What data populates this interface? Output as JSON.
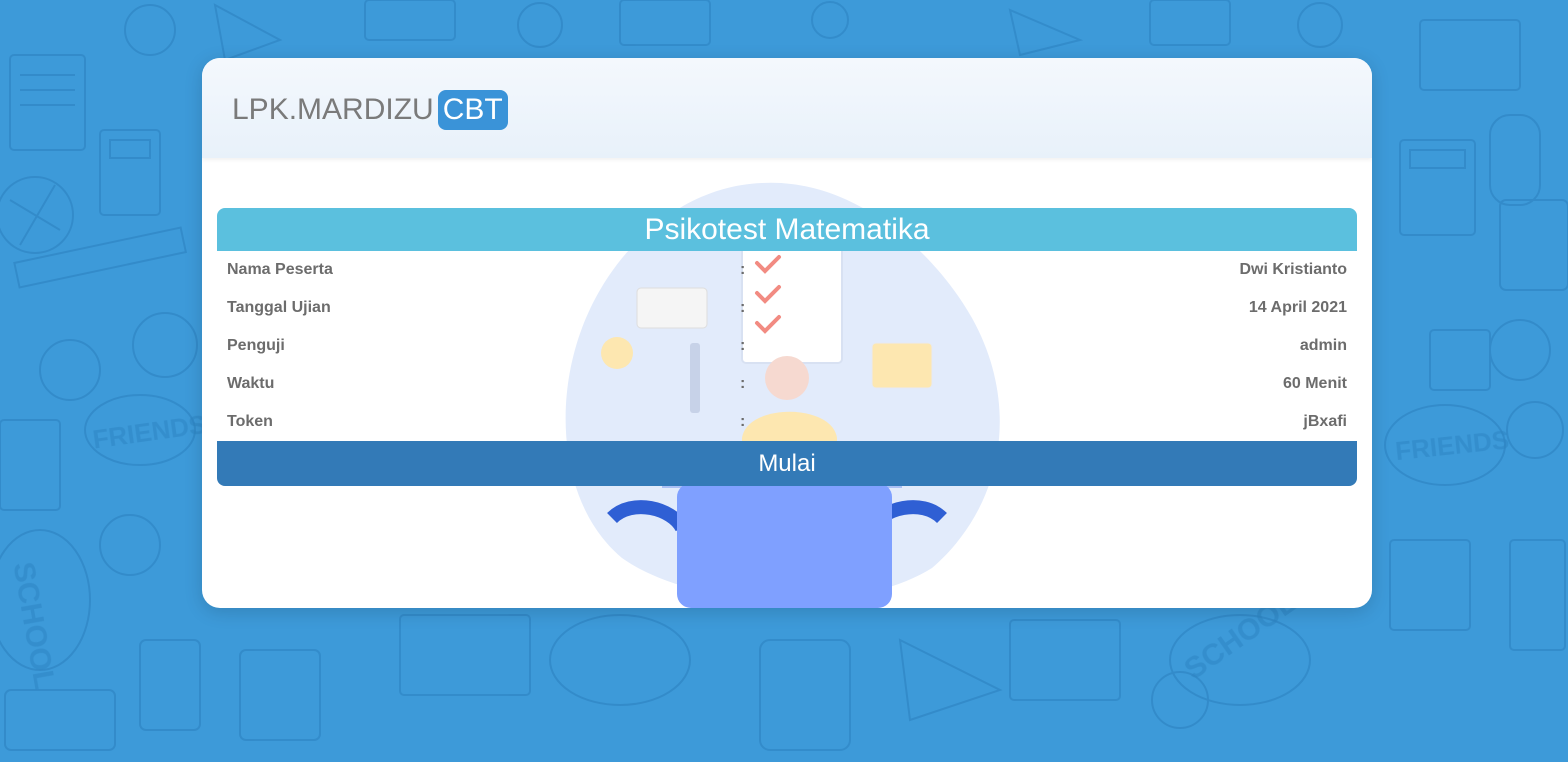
{
  "brand": {
    "name": "LPK.MARDIZU",
    "badge": "CBT"
  },
  "exam": {
    "title": "Psikotest Matematika",
    "separator": ":",
    "rows": [
      {
        "label": "Nama Peserta",
        "value": "Dwi Kristianto"
      },
      {
        "label": "Tanggal Ujian",
        "value": "14 April 2021"
      },
      {
        "label": "Penguji",
        "value": "admin"
      },
      {
        "label": "Waktu",
        "value": "60 Menit"
      },
      {
        "label": "Token",
        "value": "jBxafi"
      }
    ],
    "start_label": "Mulai"
  },
  "background_pattern": {
    "text": [
      "FRIENDS",
      "SCHOOL",
      "FRIENDS",
      "SCHOOL"
    ]
  },
  "colors": {
    "background": "#3d9ad9",
    "title_bar": "#5bc0de",
    "start_button": "#337ab7",
    "brand_badge": "#3a93d8"
  }
}
